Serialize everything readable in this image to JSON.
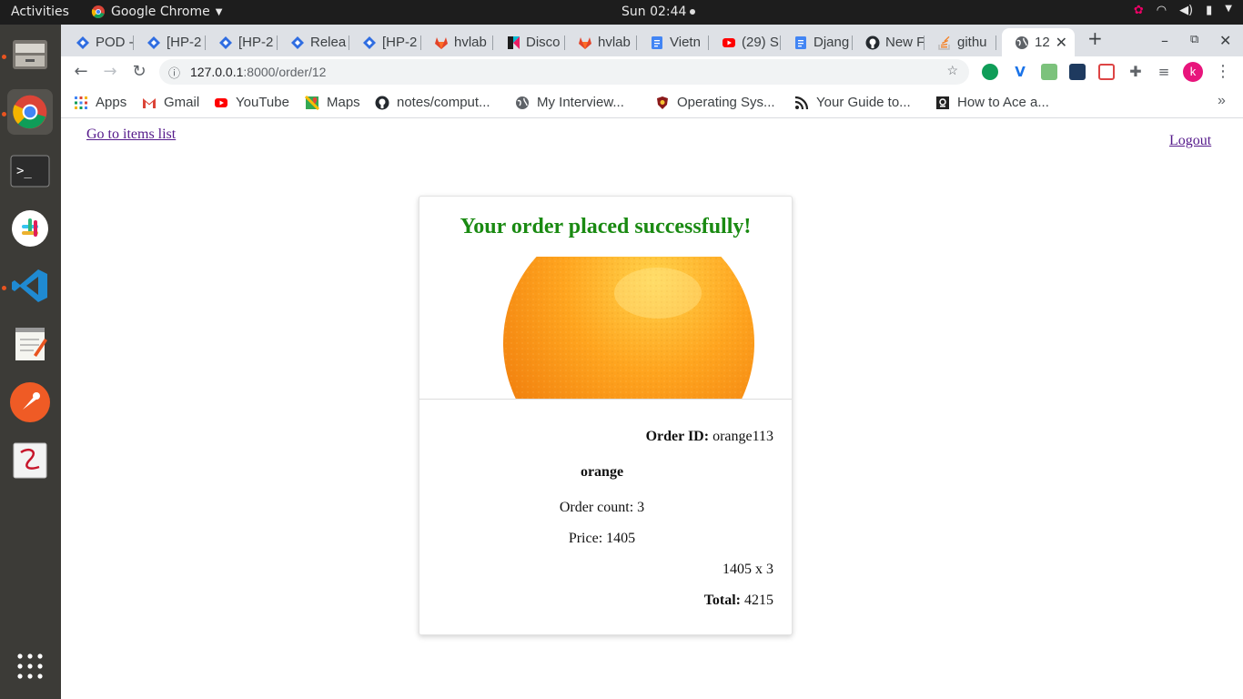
{
  "topbar": {
    "activities": "Activities",
    "app_name": "Google Chrome",
    "clock": "Sun 02:44"
  },
  "dock": {
    "items": [
      "files-icon",
      "chrome-icon",
      "terminal-icon",
      "slack-icon",
      "vscode-icon",
      "text-editor-icon",
      "postman-icon",
      "document-viewer-icon",
      "app-grid-icon"
    ]
  },
  "tabs": [
    {
      "label": "POD -",
      "icon": "diamond-icon"
    },
    {
      "label": "[HP-2",
      "icon": "diamond-icon"
    },
    {
      "label": "[HP-2",
      "icon": "diamond-icon"
    },
    {
      "label": "Relea",
      "icon": "diamond-icon"
    },
    {
      "label": "[HP-2",
      "icon": "diamond-icon"
    },
    {
      "label": "hvlab",
      "icon": "gitlab-icon"
    },
    {
      "label": "Disco",
      "icon": "k-icon"
    },
    {
      "label": "hvlab",
      "icon": "gitlab-icon"
    },
    {
      "label": "Vietn",
      "icon": "docs-icon"
    },
    {
      "label": "(29) S",
      "icon": "youtube-icon"
    },
    {
      "label": "Djang",
      "icon": "docs-icon"
    },
    {
      "label": "New F",
      "icon": "github-icon"
    },
    {
      "label": "githu",
      "icon": "stackoverflow-icon"
    },
    {
      "label": "12",
      "icon": "globe-icon"
    }
  ],
  "address_bar": {
    "host": "127.0.0.1",
    "path": ":8000/order/12"
  },
  "profile_initial": "k",
  "bookmarks": [
    {
      "label": "Apps",
      "icon": "apps-grid-icon"
    },
    {
      "label": "Gmail",
      "icon": "gmail-icon"
    },
    {
      "label": "YouTube",
      "icon": "youtube-icon"
    },
    {
      "label": "Maps",
      "icon": "maps-icon"
    },
    {
      "label": "notes/comput...",
      "icon": "github-icon"
    },
    {
      "label": "My Interview...",
      "icon": "globe-icon"
    },
    {
      "label": "Operating Sys...",
      "icon": "shield-icon"
    },
    {
      "label": "Your Guide to...",
      "icon": "rss-icon"
    },
    {
      "label": "How to Ace a...",
      "icon": "bookmark-icon"
    }
  ],
  "page": {
    "items_link": "Go to items list",
    "logout_link": "Logout",
    "order": {
      "title": "Your order placed successfully!",
      "order_id_label": "Order ID:",
      "order_id_value": "orange113",
      "item_name": "orange",
      "count_text": "Order count: 3",
      "price_text": "Price: 1405",
      "calc_text": "1405 x 3",
      "total_label": "Total:",
      "total_value": "4215"
    }
  },
  "colors": {
    "success_title": "#1a8a12",
    "link": "#551a8b",
    "dock_bg": "#3c3b37",
    "topbar_bg": "#1d1d1d"
  }
}
